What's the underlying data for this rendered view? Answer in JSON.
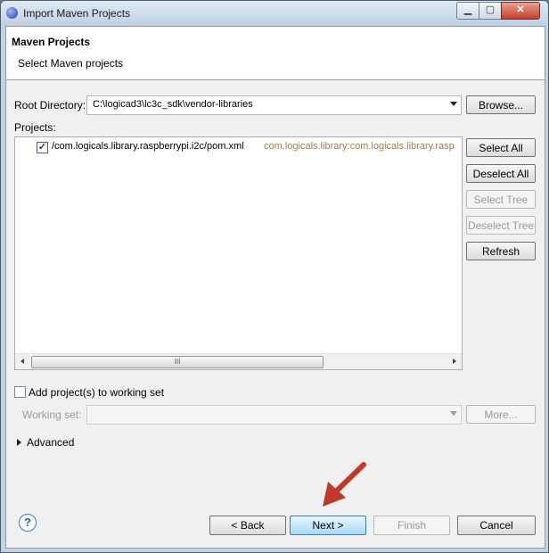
{
  "window": {
    "title": "Import Maven Projects",
    "minimize_glyph": "▁",
    "maximize_glyph": "▢",
    "close_glyph": "✕"
  },
  "header": {
    "title": "Maven Projects",
    "description": "Select Maven projects"
  },
  "root_directory": {
    "label": "Root Directory:",
    "value": "C:\\logicad3\\lc3c_sdk\\vendor-libraries",
    "browse_label": "Browse..."
  },
  "projects": {
    "label": "Projects:",
    "items": [
      {
        "checked": true,
        "checkmark": "✓",
        "path": "/com.logicals.library.raspberrypi.i2c/pom.xml",
        "artifact": "com.logicals.library:com.logicals.library.rasp"
      }
    ],
    "scrollbar_grip": "III"
  },
  "side_buttons": {
    "select_all": "Select All",
    "deselect_all": "Deselect All",
    "select_tree": "Select Tree",
    "deselect_tree": "Deselect Tree",
    "refresh": "Refresh"
  },
  "working_set": {
    "add_label": "Add project(s) to working set",
    "field_label": "Working set:",
    "more_label": "More..."
  },
  "advanced": {
    "label": "Advanced"
  },
  "footer": {
    "help_glyph": "?",
    "back_label": "< Back",
    "next_label": "Next >",
    "finish_label": "Finish",
    "cancel_label": "Cancel"
  },
  "colors": {
    "artifact_text": "#a08050",
    "annotation_arrow": "#c0392b"
  }
}
